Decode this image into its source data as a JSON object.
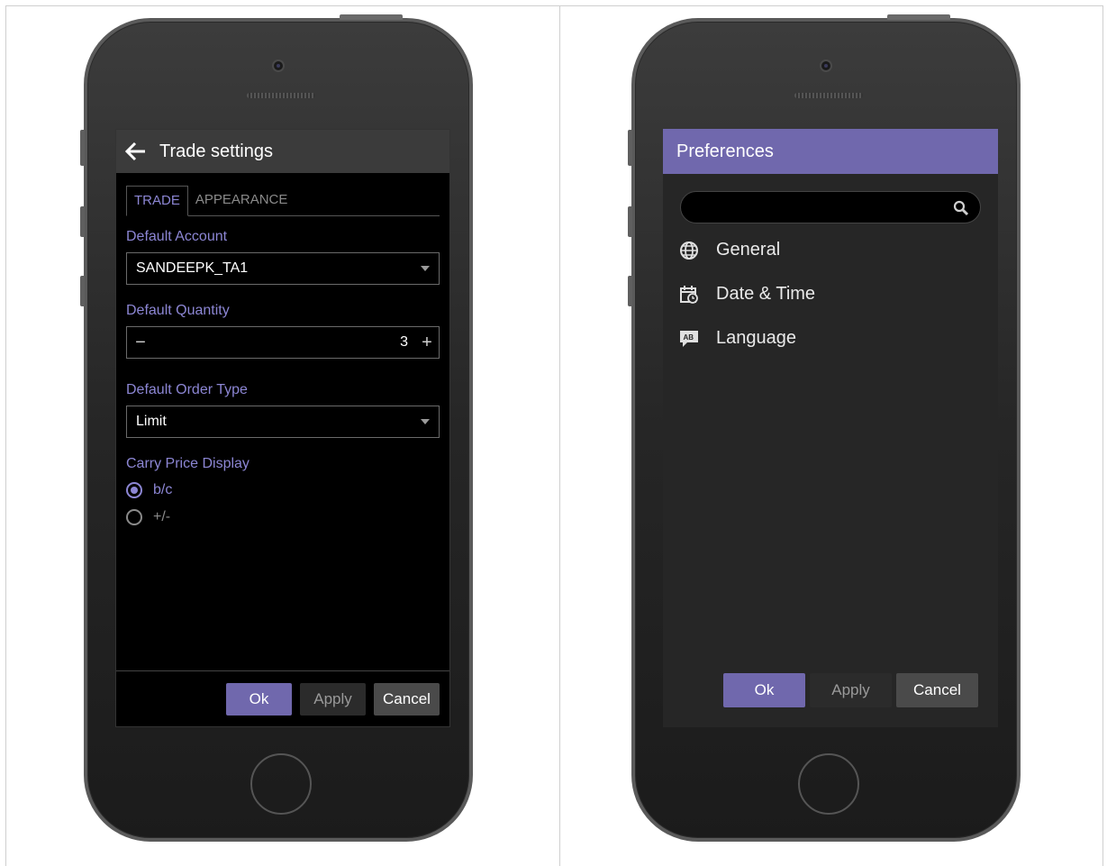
{
  "trade_settings": {
    "title": "Trade settings",
    "tabs": [
      {
        "label": "TRADE",
        "active": true
      },
      {
        "label": "APPEARANCE",
        "active": false
      }
    ],
    "default_account": {
      "label": "Default Account",
      "value": "SANDEEPK_TA1"
    },
    "default_quantity": {
      "label": "Default Quantity",
      "value": "3",
      "minus": "−",
      "plus": "+"
    },
    "default_order_type": {
      "label": "Default Order Type",
      "value": "Limit"
    },
    "carry_price_display": {
      "label": "Carry Price Display",
      "options": [
        {
          "label": "b/c",
          "selected": true
        },
        {
          "label": "+/-",
          "selected": false
        }
      ]
    },
    "buttons": {
      "ok": "Ok",
      "apply": "Apply",
      "cancel": "Cancel"
    }
  },
  "preferences": {
    "title": "Preferences",
    "search": {
      "value": "",
      "placeholder": "",
      "icon": "search-icon"
    },
    "items": [
      {
        "label": "General",
        "icon": "globe-icon"
      },
      {
        "label": "Date & Time",
        "icon": "calendar-clock-icon"
      },
      {
        "label": "Language",
        "icon": "language-icon"
      }
    ],
    "buttons": {
      "ok": "Ok",
      "apply": "Apply",
      "cancel": "Cancel"
    }
  },
  "colors": {
    "accent": "#7068ad",
    "accent_text": "#8c86d4",
    "background_dark": "#000000",
    "panel_dark": "#262626"
  }
}
